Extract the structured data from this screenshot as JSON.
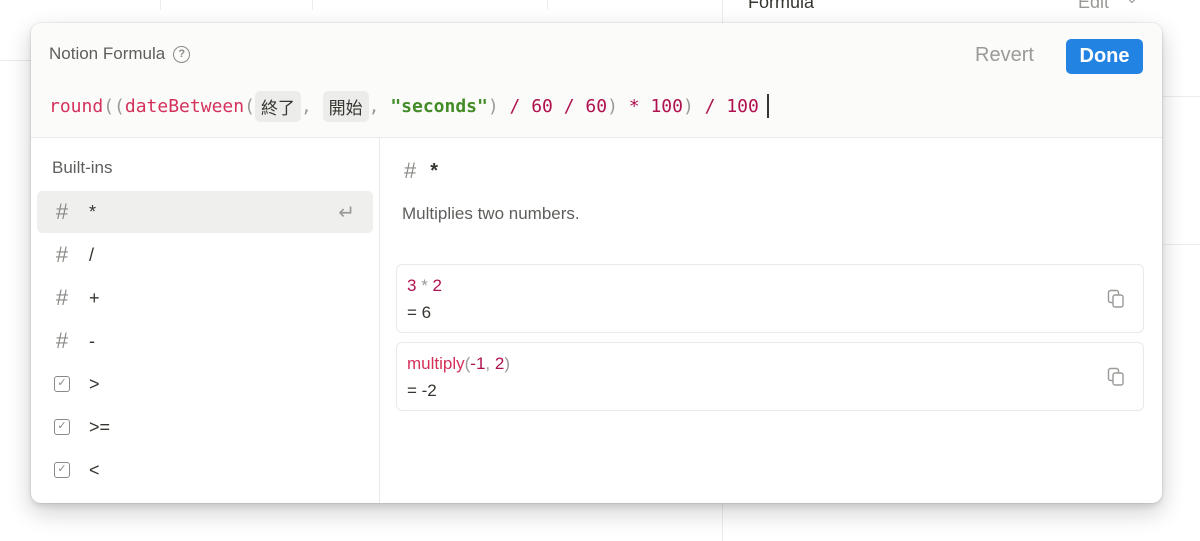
{
  "background": {
    "formula_label": "Formula",
    "edit_label": "Edit"
  },
  "modal": {
    "title": "Notion Formula",
    "revert_label": "Revert",
    "done_label": "Done",
    "accent_color": "#2383e2",
    "formula": {
      "t1": "round",
      "t2": "((",
      "t3": "dateBetween",
      "t4": "(",
      "chip1": "終了",
      "t5": ", ",
      "chip2": "開始",
      "t6": ", ",
      "t7": "\"seconds\"",
      "t8": ")",
      "t9": " / ",
      "t10": "60",
      "t11": " / ",
      "t12": "60",
      "t13": ")",
      "t14": " * ",
      "t15": "100",
      "t16": ")",
      "t17": " / ",
      "t18": "100"
    }
  },
  "sidebar": {
    "heading": "Built-ins",
    "items": [
      {
        "icon": "#",
        "label": "*"
      },
      {
        "icon": "#",
        "label": "/"
      },
      {
        "icon": "#",
        "label": "+"
      },
      {
        "icon": "#",
        "label": "-"
      },
      {
        "icon": "checkbox",
        "label": ">"
      },
      {
        "icon": "checkbox",
        "label": ">="
      },
      {
        "icon": "checkbox",
        "label": "<"
      }
    ]
  },
  "detail": {
    "icon": "#",
    "name": "*",
    "description": "Multiplies two numbers.",
    "examples": [
      {
        "a": "3",
        "op": " * ",
        "b": "2",
        "result": "= 6"
      },
      {
        "fn": "multiply",
        "open": "(",
        "arg1": "-1",
        "sep": ", ",
        "arg2": "2",
        "close": ")",
        "result": "= -2"
      }
    ]
  }
}
